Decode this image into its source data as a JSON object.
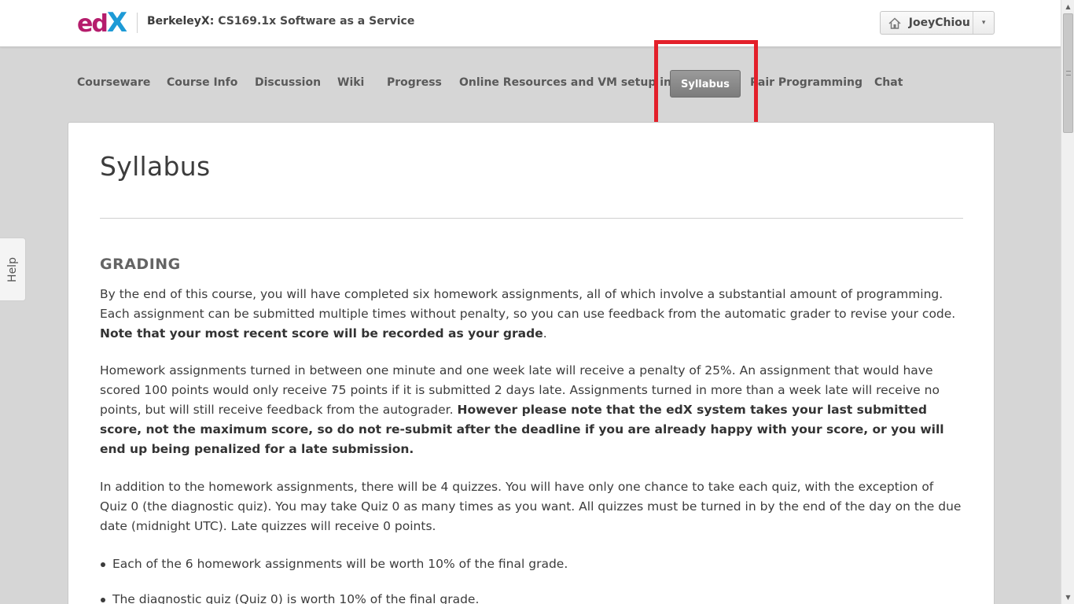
{
  "header": {
    "logo": {
      "e": "e",
      "d": "d",
      "x": "X"
    },
    "course_org": "BerkeleyX:",
    "course_name": "CS169.1x Software as a Service",
    "user": {
      "name": "JoeyChiou",
      "home_icon": "home-icon",
      "caret": "▾"
    }
  },
  "nav": {
    "items": [
      {
        "label": "Courseware"
      },
      {
        "label": "Course Info"
      },
      {
        "label": "Discussion"
      },
      {
        "label": "Wiki"
      },
      {
        "label": "Progress"
      },
      {
        "label": "Online Resources and VM setup info"
      },
      {
        "label": "Syllabus",
        "active": true
      },
      {
        "label": "Pair Programming"
      },
      {
        "label": "Chat"
      }
    ]
  },
  "help_tab": {
    "label": "Help"
  },
  "content": {
    "title": "Syllabus",
    "section_heading": "GRADING",
    "p1_text": "By the end of this course, you will have completed six homework assignments, all of which involve a substantial amount of programming. Each assignment can be submitted multiple times without penalty, so you can use feedback from the automatic grader to revise your code. ",
    "p1_bold": "Note that your most recent score will be recorded as your grade",
    "p1_end": ".",
    "p2_text": "Homework assignments turned in between one minute and one week late will receive a penalty of 25%. An assignment that would have scored 100 points would only receive 75 points if it is submitted 2 days late. Assignments turned in more than a week late will receive no points, but will still receive feedback from the autograder.  ",
    "p2_bold": "However please note that the edX system takes your last submitted score, not the maximum score, so do not re-submit after the deadline if you are already happy with your score, or you will end up being penalized for a late submission.",
    "p3_text": "In addition to the homework assignments, there will be 4 quizzes. You will have only one chance to take each quiz, with the exception of Quiz 0 (the diagnostic quiz). You may take Quiz 0 as many times as you want. All quizzes must be turned in by the end of the day on the due date (midnight UTC). Late quizzes will receive 0 points.",
    "bullets": [
      "Each of the 6 homework assignments will be worth 10% of the final grade.",
      "The diagnostic quiz (Quiz 0) is worth 10% of the final grade."
    ]
  },
  "colors": {
    "brand_magenta": "#b51d6c",
    "brand_blue": "#1d9ad6",
    "highlight_red": "#e3202a",
    "active_tab": "#8a8a8a"
  }
}
